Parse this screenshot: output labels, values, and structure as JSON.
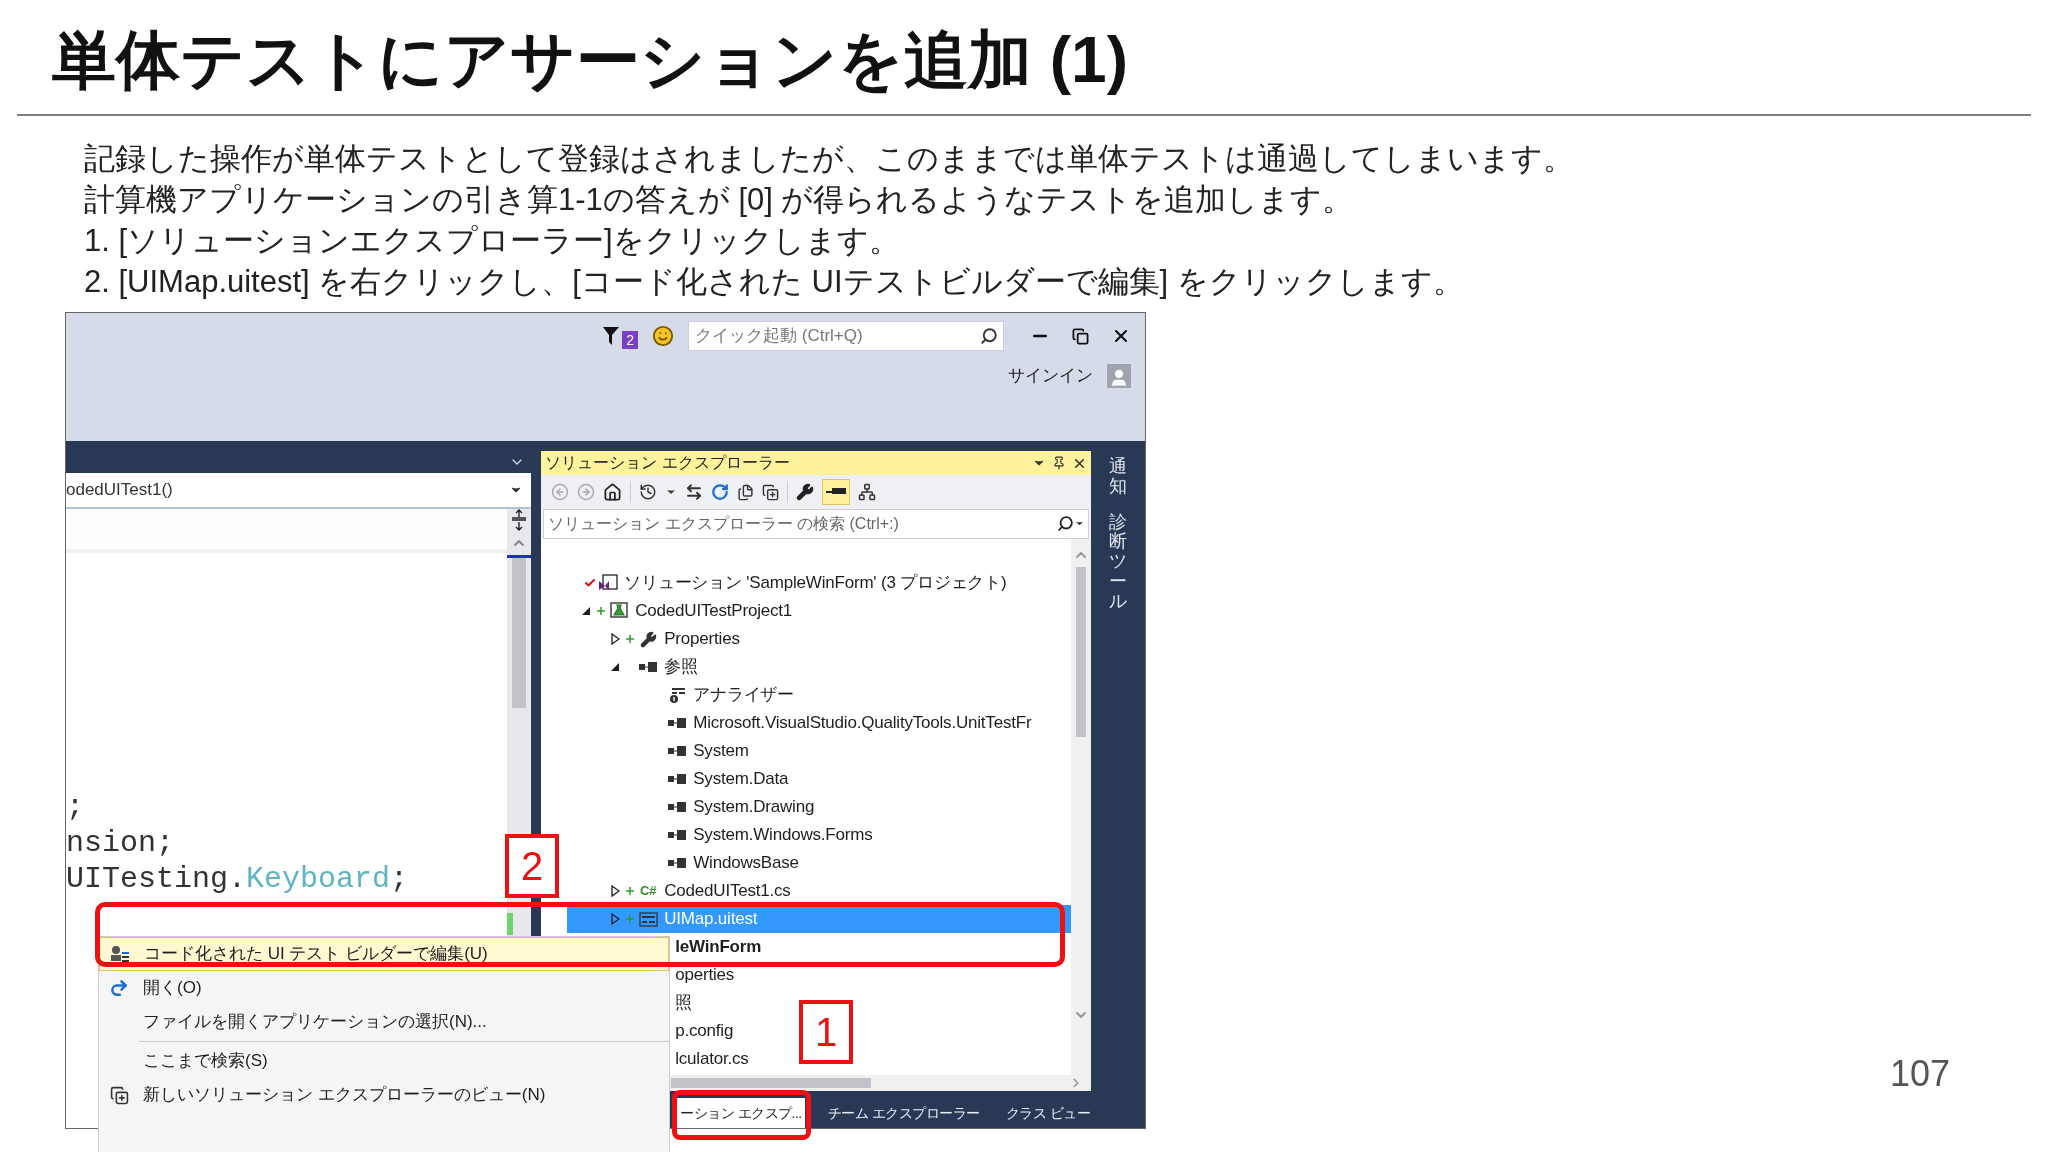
{
  "slide": {
    "title": "単体テストにアサーションを追加 (1)",
    "body": [
      "記録した操作が単体テストとして登録はされましたが、このままでは単体テストは通過してしまいます。",
      "計算機アプリケーションの引き算1-1の答えが [0] が得られるようなテストを追加します。",
      "1. [ソリューションエクスプローラー]をクリックします。",
      "2. [UIMap.uitest] を右クリックし、[コード化された UIテストビルダーで編集] をクリックします。"
    ],
    "page_number": "107"
  },
  "screenshot": {
    "title_bar": {
      "notification_count": "2",
      "quick_launch": {
        "placeholder": "クイック起動 (Ctrl+Q)"
      },
      "sign_in": "サインイン"
    },
    "editor": {
      "member_dropdown": "odedUITest1()",
      "code_lines": [
        [
          {
            "text": ";",
            "kind": "plain"
          }
        ],
        [
          {
            "text": "nsion;",
            "kind": "plain"
          }
        ],
        [
          {
            "text": "UITesting.",
            "kind": "plain"
          },
          {
            "text": "Keyboard",
            "kind": "type"
          },
          {
            "text": ";",
            "kind": "plain"
          }
        ]
      ]
    },
    "solution_explorer": {
      "title": "ソリューション エクスプローラー",
      "preview_toggle": {
        "on": true
      },
      "search": {
        "placeholder": "ソリューション エクスプローラー の検索 (Ctrl+:)"
      },
      "tree": [
        {
          "label": "ソリューション 'SampleWinForm' (3 プロジェクト)",
          "kind": "solution",
          "checked_in": true,
          "selected": false,
          "children": [
            {
              "label": "CodedUITestProject1",
              "kind": "project",
              "pending_add": true,
              "expanded": true,
              "selected": false,
              "children": [
                {
                  "label": "Properties",
                  "kind": "properties",
                  "pending_add": true,
                  "expanded": false,
                  "selected": false
                },
                {
                  "label": "参照",
                  "kind": "references",
                  "expanded": true,
                  "selected": false,
                  "children": [
                    {
                      "label": "アナライザー",
                      "kind": "analyzer",
                      "selected": false
                    },
                    {
                      "label": "Microsoft.VisualStudio.QualityTools.UnitTestFr",
                      "kind": "reference",
                      "selected": false
                    },
                    {
                      "label": "System",
                      "kind": "reference",
                      "selected": false
                    },
                    {
                      "label": "System.Data",
                      "kind": "reference",
                      "selected": false
                    },
                    {
                      "label": "System.Drawing",
                      "kind": "reference",
                      "selected": false
                    },
                    {
                      "label": "System.Windows.Forms",
                      "kind": "reference",
                      "selected": false
                    },
                    {
                      "label": "WindowsBase",
                      "kind": "reference",
                      "selected": false
                    }
                  ]
                },
                {
                  "label": "CodedUITest1.cs",
                  "kind": "csharp",
                  "icon_text": "C#",
                  "pending_add": true,
                  "expanded": false,
                  "selected": false
                },
                {
                  "label": "UIMap.uitest",
                  "kind": "uitest",
                  "pending_add": true,
                  "expanded": false,
                  "selected": true
                }
              ]
            },
            {
              "label": "leWinForm",
              "kind": "covered",
              "bold": true,
              "selected": false,
              "children": [
                {
                  "label": "operties",
                  "kind": "covered",
                  "selected": false
                },
                {
                  "label": "照",
                  "kind": "covered",
                  "selected": false
                },
                {
                  "label": "p.config",
                  "kind": "covered",
                  "selected": false
                },
                {
                  "label": "lculator.cs",
                  "kind": "covered",
                  "selected": false
                }
              ]
            }
          ]
        }
      ],
      "tabs": [
        {
          "label": "ーション エクスプ...",
          "selected": true
        },
        {
          "label": "チーム エクスプローラー",
          "selected": false
        },
        {
          "label": "クラス ビュー",
          "selected": false
        }
      ]
    },
    "side_tabs": [
      "通知",
      "診断ツール"
    ],
    "context_menu": [
      {
        "kind": "builder",
        "label": "コード化された UI テスト ビルダーで編集(U)",
        "highlighted": true
      },
      {
        "kind": "open",
        "label": "開く(O)",
        "highlighted": false
      },
      {
        "kind": "plain",
        "label": "ファイルを開くアプリケーションの選択(N)...",
        "highlighted": false
      },
      {
        "kind": "separator"
      },
      {
        "kind": "plain",
        "label": "ここまで検索(S)",
        "highlighted": false
      },
      {
        "kind": "new_view",
        "label": "新しいソリューション エクスプローラーのビュー(N)",
        "highlighted": false
      }
    ],
    "callouts": [
      "2",
      "1"
    ]
  }
}
